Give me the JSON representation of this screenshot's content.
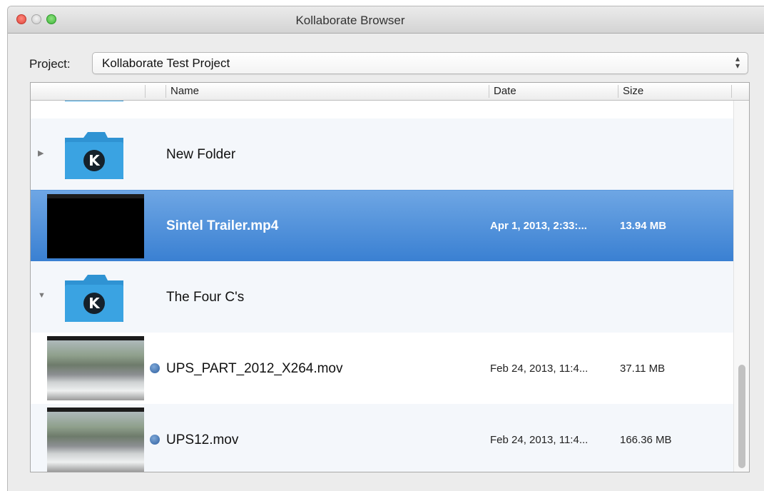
{
  "window": {
    "title": "Kollaborate Browser"
  },
  "project": {
    "label": "Project:",
    "selected": "Kollaborate Test Project",
    "arrows": "⌃⌄"
  },
  "columns": {
    "name": "Name",
    "date": "Date",
    "size": "Size"
  },
  "rows": [
    {
      "type": "folder",
      "name": "New Folder",
      "date": "",
      "size": "",
      "expanded": false
    },
    {
      "type": "video",
      "name": "Sintel Trailer.mp4",
      "date": "Apr 1, 2013, 2:33:...",
      "size": "13.94 MB",
      "selected": true
    },
    {
      "type": "folder",
      "name": "The Four C's",
      "date": "",
      "size": "",
      "expanded": true
    },
    {
      "type": "video",
      "name": "UPS_PART_2012_X264.mov",
      "date": "Feb 24, 2013, 11:4...",
      "size": "37.11 MB",
      "status_dot": true
    },
    {
      "type": "video",
      "name": "UPS12.mov",
      "date": "Feb 24, 2013, 11:4...",
      "size": "166.36 MB",
      "status_dot": true
    }
  ],
  "colors": {
    "selection": "#3a80d2",
    "folder": "#2f93d3",
    "status_dot": "#2e5f9f"
  },
  "icons": {
    "folder": "folder-icon",
    "kollaborate_logo": "k-logo-icon",
    "disclosure_collapsed": "disclosure-right-icon",
    "disclosure_expanded": "disclosure-down-icon"
  }
}
